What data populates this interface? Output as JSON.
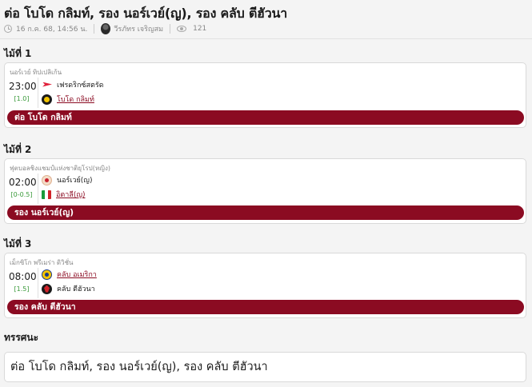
{
  "article": {
    "title": "ต่อ โบโด กลิมท์, รอง นอร์เวย์(ญ), รอง คลับ ตีฮัวนา",
    "date": "16 ก.ค. 68, 14:56 น.",
    "author": "วีรภัทร เจริญสม",
    "views": "121"
  },
  "picks": [
    {
      "heading": "ไม้ที่ 1",
      "league": "นอร์เวย์ ทิปเปลิเก้น",
      "time": "23:00",
      "handicap": "[1.0]",
      "home": {
        "name": "เฟรดริกซ์สตรัด",
        "favored": false,
        "logo": "fredrikstad-crest-icon"
      },
      "away": {
        "name": "โบโด กลิมท์",
        "favored": true,
        "logo": "bodo-glimt-crest-icon"
      },
      "pick_label": "ต่อ โบโด กลิมท์"
    },
    {
      "heading": "ไม้ที่ 2",
      "league": "ฟุตบอลชิงแชมป์แห่งชาติยุโรป(หญิง)",
      "time": "02:00",
      "handicap": "[0-0.5]",
      "home": {
        "name": "นอร์เวย์(ญ)",
        "favored": false,
        "logo": "norway-crest-icon"
      },
      "away": {
        "name": "อิตาลี(ญ)",
        "favored": true,
        "logo": "italy-flag-icon"
      },
      "pick_label": "รอง นอร์เวย์(ญ)"
    },
    {
      "heading": "ไม้ที่ 3",
      "league": "เม็กซิโก พรีเมร่า ดิวิชั่น",
      "time": "08:00",
      "handicap": "[1.5]",
      "home": {
        "name": "คลับ อเมริกา",
        "favored": true,
        "logo": "club-america-crest-icon"
      },
      "away": {
        "name": "คลับ ตีฮัวนา",
        "favored": false,
        "logo": "tijuana-crest-icon"
      },
      "pick_label": "รอง คลับ ตีฮัวนา"
    }
  ],
  "verdict": {
    "heading": "ทรรศนะ",
    "text": "ต่อ โบโด กลิมท์, รอง นอร์เวย์(ญ), รอง คลับ ตีฮัวนา"
  },
  "colors": {
    "accent": "#8b0b22",
    "handicap": "#3a9a3a"
  }
}
